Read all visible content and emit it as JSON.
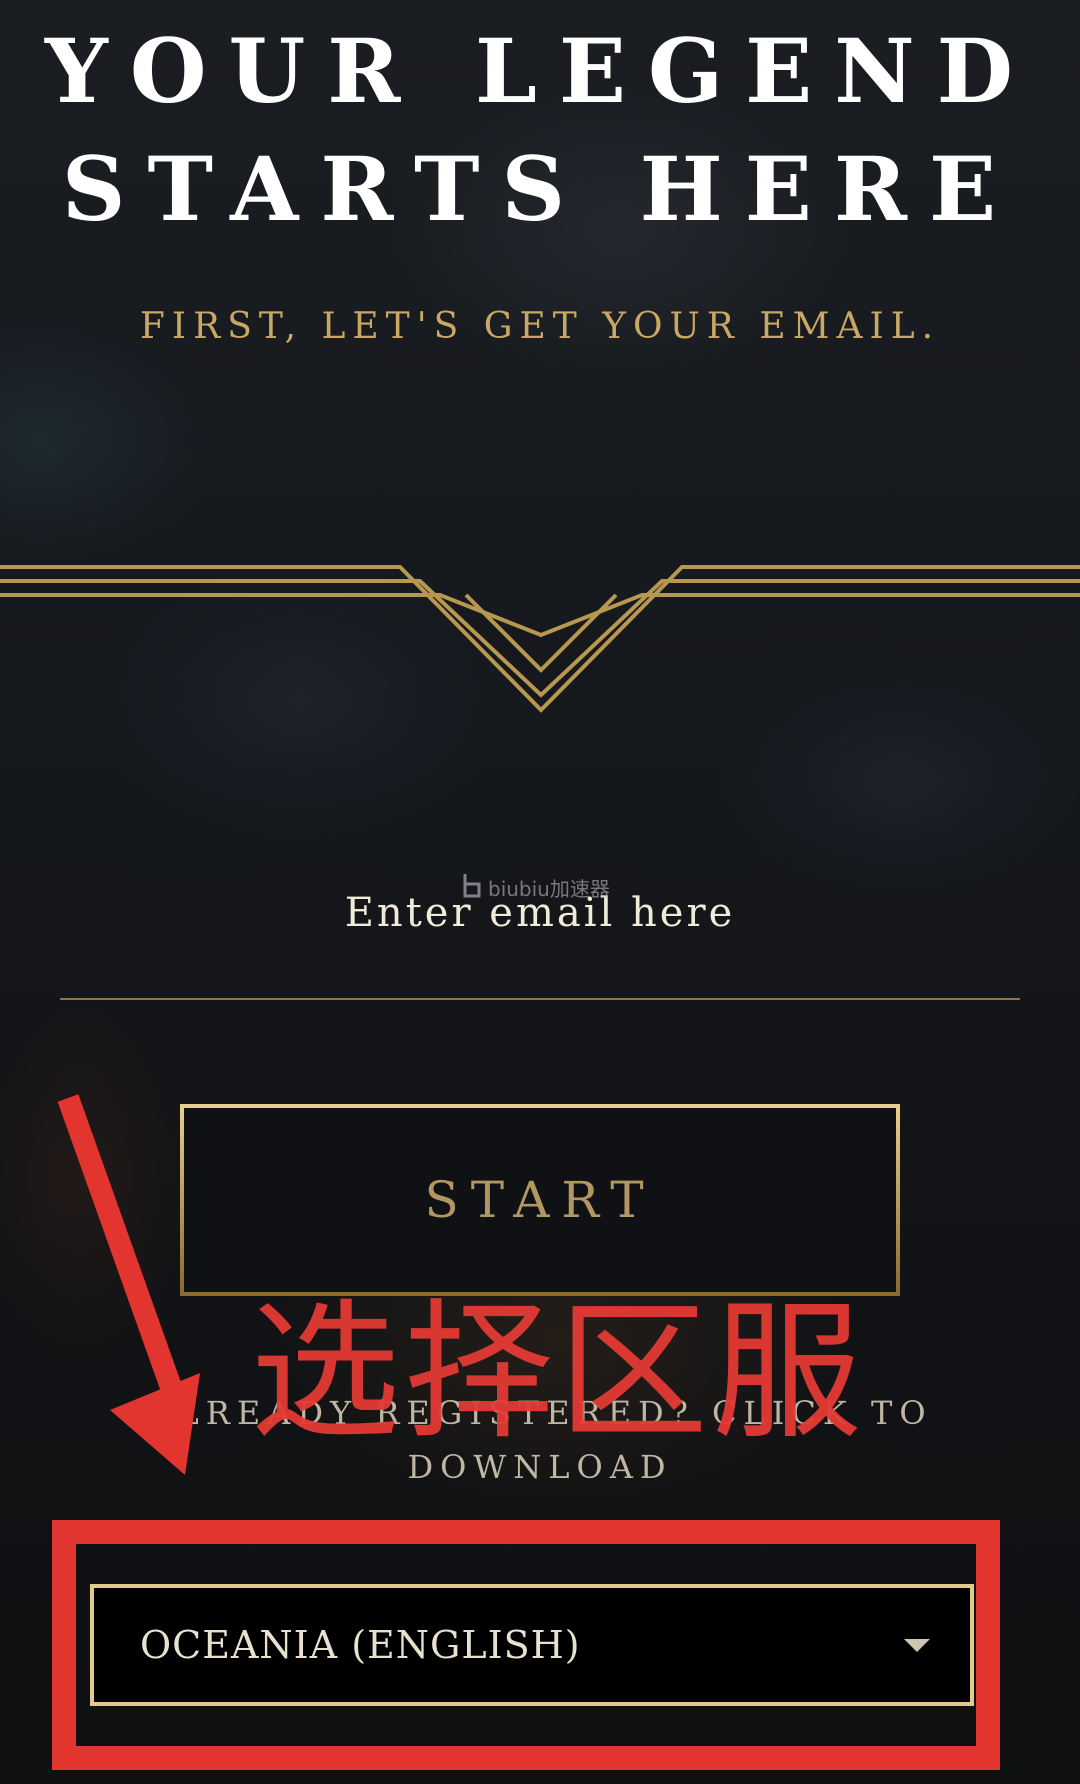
{
  "headline": {
    "line1": "YOUR LEGEND",
    "line2": "STARTS HERE"
  },
  "subtitle": "FIRST, LET'S GET YOUR EMAIL.",
  "email": {
    "placeholder": "Enter email here",
    "value": ""
  },
  "watermark": "biubiu加速器",
  "start_button": "START",
  "already_registered": "ALREADY REGISTERED? CLICK TO DOWNLOAD",
  "annotation_text": "选择区服",
  "region_select": {
    "selected": "OCEANIA (ENGLISH)"
  },
  "colors": {
    "gold": "#c8aa6e",
    "annotation_red": "#e23530",
    "background": "#15181c"
  }
}
